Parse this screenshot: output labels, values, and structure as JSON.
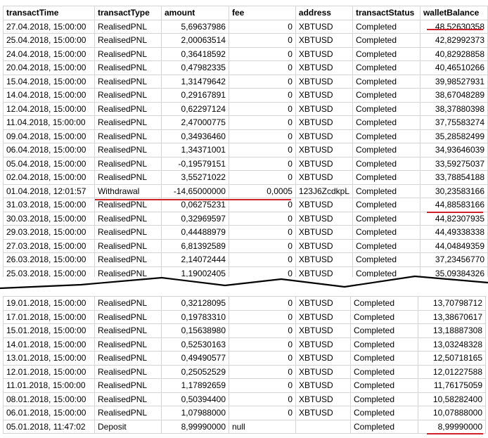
{
  "columns": [
    "transactTime",
    "transactType",
    "amount",
    "fee",
    "address",
    "transactStatus",
    "walletBalance"
  ],
  "top_rows": [
    [
      "27.04.2018, 15:00:00",
      "RealisedPNL",
      "5,69637986",
      "0",
      "XBTUSD",
      "Completed",
      "48,52630358"
    ],
    [
      "25.04.2018, 15:00:00",
      "RealisedPNL",
      "2,00063514",
      "0",
      "XBTUSD",
      "Completed",
      "42,82992373"
    ],
    [
      "24.04.2018, 15:00:00",
      "RealisedPNL",
      "0,36418592",
      "0",
      "XBTUSD",
      "Completed",
      "40,82928858"
    ],
    [
      "20.04.2018, 15:00:00",
      "RealisedPNL",
      "0,47982335",
      "0",
      "XBTUSD",
      "Completed",
      "40,46510266"
    ],
    [
      "15.04.2018, 15:00:00",
      "RealisedPNL",
      "1,31479642",
      "0",
      "XBTUSD",
      "Completed",
      "39,98527931"
    ],
    [
      "14.04.2018, 15:00:00",
      "RealisedPNL",
      "0,29167891",
      "0",
      "XBTUSD",
      "Completed",
      "38,67048289"
    ],
    [
      "12.04.2018, 15:00:00",
      "RealisedPNL",
      "0,62297124",
      "0",
      "XBTUSD",
      "Completed",
      "38,37880398"
    ],
    [
      "11.04.2018, 15:00:00",
      "RealisedPNL",
      "2,47000775",
      "0",
      "XBTUSD",
      "Completed",
      "37,75583274"
    ],
    [
      "09.04.2018, 15:00:00",
      "RealisedPNL",
      "0,34936460",
      "0",
      "XBTUSD",
      "Completed",
      "35,28582499"
    ],
    [
      "06.04.2018, 15:00:00",
      "RealisedPNL",
      "1,34371001",
      "0",
      "XBTUSD",
      "Completed",
      "34,93646039"
    ],
    [
      "05.04.2018, 15:00:00",
      "RealisedPNL",
      "-0,19579151",
      "0",
      "XBTUSD",
      "Completed",
      "33,59275037"
    ],
    [
      "02.04.2018, 15:00:00",
      "RealisedPNL",
      "3,55271022",
      "0",
      "XBTUSD",
      "Completed",
      "33,78854188"
    ],
    [
      "01.04.2018, 12:01:57",
      "Withdrawal",
      "-14,65000000",
      "0,0005",
      "123J6ZcdkpL",
      "Completed",
      "30,23583166"
    ],
    [
      "31.03.2018, 15:00:00",
      "RealisedPNL",
      "0,06275231",
      "0",
      "XBTUSD",
      "Completed",
      "44,88583166"
    ],
    [
      "30.03.2018, 15:00:00",
      "RealisedPNL",
      "0,32969597",
      "0",
      "XBTUSD",
      "Completed",
      "44,82307935"
    ],
    [
      "29.03.2018, 15:00:00",
      "RealisedPNL",
      "0,44488979",
      "0",
      "XBTUSD",
      "Completed",
      "44,49338338"
    ],
    [
      "27.03.2018, 15:00:00",
      "RealisedPNL",
      "6,81392589",
      "0",
      "XBTUSD",
      "Completed",
      "44,04849359"
    ],
    [
      "26.03.2018, 15:00:00",
      "RealisedPNL",
      "2,14072444",
      "0",
      "XBTUSD",
      "Completed",
      "37,23456770"
    ],
    [
      "25.03.2018, 15:00:00",
      "RealisedPNL",
      "1,19002405",
      "0",
      "XBTUSD",
      "Completed",
      "35,09384326"
    ]
  ],
  "bottom_rows": [
    [
      "19.01.2018, 15:00:00",
      "RealisedPNL",
      "0,32128095",
      "0",
      "XBTUSD",
      "Completed",
      "13,70798712"
    ],
    [
      "17.01.2018, 15:00:00",
      "RealisedPNL",
      "0,19783310",
      "0",
      "XBTUSD",
      "Completed",
      "13,38670617"
    ],
    [
      "15.01.2018, 15:00:00",
      "RealisedPNL",
      "0,15638980",
      "0",
      "XBTUSD",
      "Completed",
      "13,18887308"
    ],
    [
      "14.01.2018, 15:00:00",
      "RealisedPNL",
      "0,52530163",
      "0",
      "XBTUSD",
      "Completed",
      "13,03248328"
    ],
    [
      "13.01.2018, 15:00:00",
      "RealisedPNL",
      "0,49490577",
      "0",
      "XBTUSD",
      "Completed",
      "12,50718165"
    ],
    [
      "12.01.2018, 15:00:00",
      "RealisedPNL",
      "0,25052529",
      "0",
      "XBTUSD",
      "Completed",
      "12,01227588"
    ],
    [
      "11.01.2018, 15:00:00",
      "RealisedPNL",
      "1,17892659",
      "0",
      "XBTUSD",
      "Completed",
      "11,76175059"
    ],
    [
      "08.01.2018, 15:00:00",
      "RealisedPNL",
      "0,50394400",
      "0",
      "XBTUSD",
      "Completed",
      "10,58282400"
    ],
    [
      "06.01.2018, 15:00:00",
      "RealisedPNL",
      "1,07988000",
      "0",
      "XBTUSD",
      "Completed",
      "10,07888000"
    ],
    [
      "05.01.2018, 11:47:02",
      "Deposit",
      "8,99990000",
      "null",
      "",
      "Completed",
      "8,99990000"
    ]
  ],
  "colors": {
    "highlight": "#d0202a",
    "grid": "#d4d4d4",
    "break_line": "#000000"
  }
}
